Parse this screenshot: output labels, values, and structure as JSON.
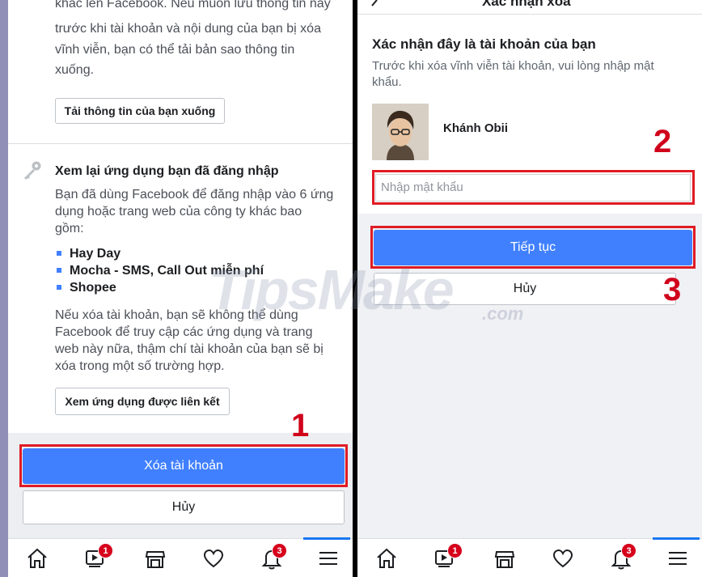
{
  "left": {
    "intro_lines": [
      "khác lên Facebook. Nếu muốn lưu thông tin này",
      "trước khi tài khoản và nội dung của bạn bị xóa",
      "vĩnh viễn, bạn có thể tải bản sao thông tin",
      "xuống."
    ],
    "download_button": "Tải thông tin của bạn xuống",
    "apps_title": "Xem lại ứng dụng bạn đã đăng nhập",
    "apps_desc_lines": [
      "Bạn đã dùng Facebook để đăng nhập vào 6 ứng",
      "dụng hoặc trang web của công ty khác bao",
      "gồm:"
    ],
    "apps": [
      "Hay Day",
      "Mocha - SMS, Call Out miễn phí",
      "Shopee"
    ],
    "warning_lines": [
      "Nếu xóa tài khoản, bạn sẽ không thể dùng",
      "Facebook để truy cập các ứng dụng và trang",
      "web này nữa, thậm chí tài khoản của bạn sẽ bị",
      "xóa trong một số trường hợp."
    ],
    "linked_apps_button": "Xem ứng dụng được liên kết",
    "delete_button": "Xóa tài khoản",
    "cancel_button": "Hủy",
    "step_number": "1"
  },
  "right": {
    "header_title": "Xác nhận xóa",
    "confirm_title": "Xác nhận đây là tài khoản của bạn",
    "confirm_desc_lines": [
      "Trước khi xóa vĩnh viễn tài khoản, vui lòng nhập mật",
      "khẩu."
    ],
    "user_name": "Khánh Obii",
    "password_placeholder": "Nhập mật khẩu",
    "continue_button": "Tiếp tục",
    "cancel_button": "Hủy",
    "step_two": "2",
    "step_three": "3"
  },
  "tabbar": {
    "video_badge": "1",
    "notification_badge": "3"
  },
  "watermark": {
    "main": "TipsMake",
    "suffix": ".com"
  },
  "colors": {
    "facebook_blue": "#4080ff",
    "annotation_red": "#e01b24"
  }
}
